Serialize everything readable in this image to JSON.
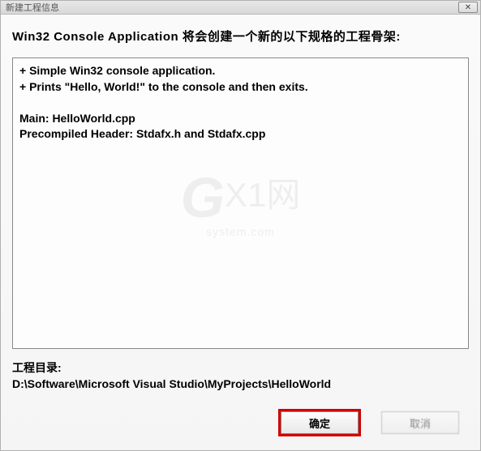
{
  "titlebar": {
    "title": "新建工程信息"
  },
  "heading": "Win32 Console Application 将会创建一个新的以下规格的工程骨架:",
  "info_box_text": "+ Simple Win32 console application.\n+ Prints \"Hello, World!\" to the console and then exits.\n\nMain: HelloWorld.cpp\nPrecompiled Header: Stdafx.h and Stdafx.cpp",
  "watermark": {
    "brand_g": "G",
    "brand_text": "X1网",
    "sub": "system.com"
  },
  "dir_section": {
    "label": "工程目录:",
    "path": "D:\\Software\\Microsoft Visual Studio\\MyProjects\\HelloWorld"
  },
  "buttons": {
    "ok": "确定",
    "cancel": "取消"
  }
}
